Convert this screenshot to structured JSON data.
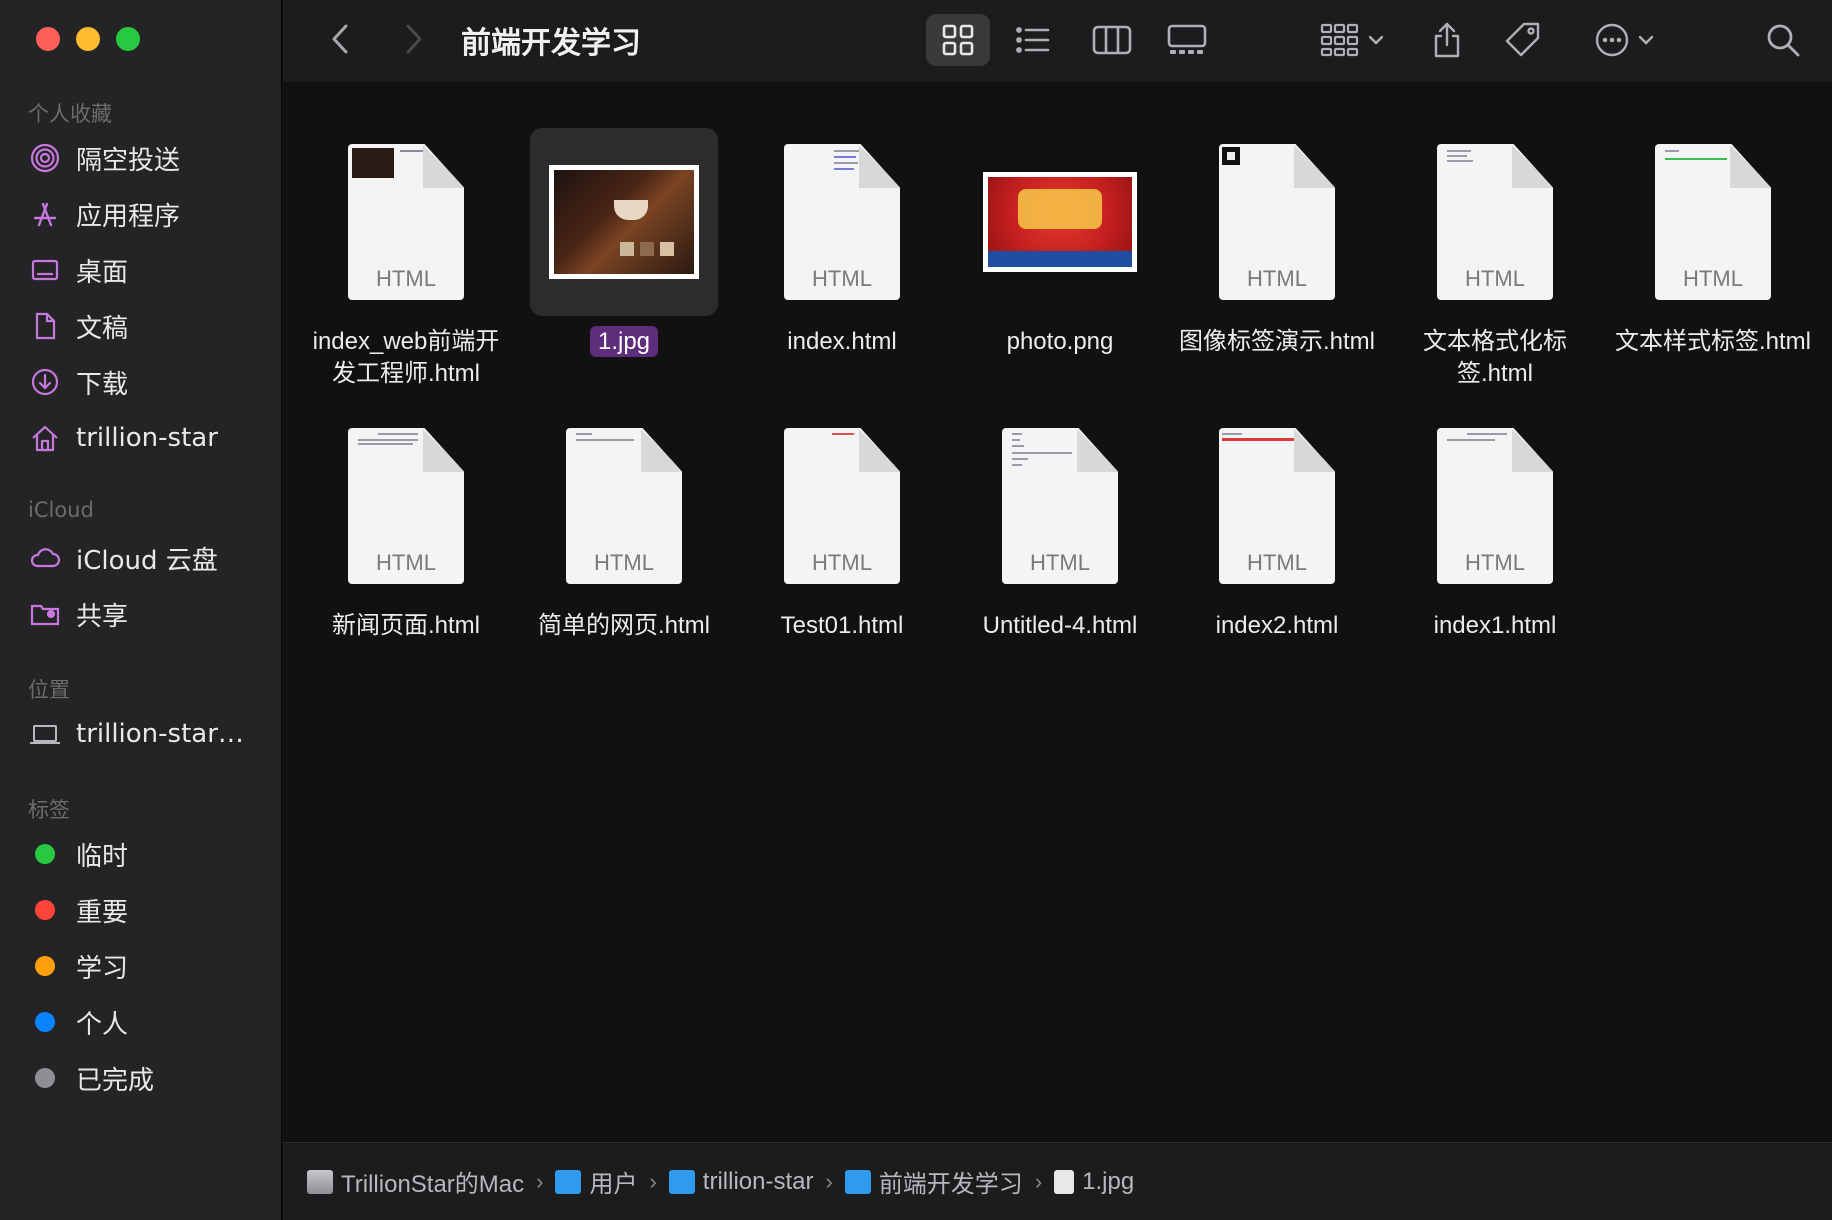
{
  "sidebar": {
    "favorites_header": "个人收藏",
    "favorites": [
      {
        "label": "隔空投送",
        "icon": "airdrop-icon"
      },
      {
        "label": "应用程序",
        "icon": "applications-icon"
      },
      {
        "label": "桌面",
        "icon": "desktop-icon"
      },
      {
        "label": "文稿",
        "icon": "document-icon"
      },
      {
        "label": "下载",
        "icon": "download-icon"
      },
      {
        "label": "trillion-star",
        "icon": "home-icon"
      }
    ],
    "icloud_header": "iCloud",
    "icloud": [
      {
        "label": "iCloud 云盘",
        "icon": "cloud-icon"
      },
      {
        "label": "共享",
        "icon": "shared-folder-icon"
      }
    ],
    "locations_header": "位置",
    "locations": [
      {
        "label": "trillion-star…",
        "icon": "laptop-icon"
      }
    ],
    "tags_header": "标签",
    "tags": [
      {
        "label": "临时",
        "color": "#28c840"
      },
      {
        "label": "重要",
        "color": "#ff453a"
      },
      {
        "label": "学习",
        "color": "#ff9f0a"
      },
      {
        "label": "个人",
        "color": "#0a84ff"
      },
      {
        "label": "已完成",
        "color": "#8e8e93"
      }
    ]
  },
  "toolbar": {
    "title": "前端开发学习",
    "view_mode": "icons"
  },
  "files": [
    {
      "name": "index_web前端开发工程师.html",
      "kind": "HTML",
      "type": "html-dark-preview"
    },
    {
      "name": "1.jpg",
      "kind": "JPG",
      "type": "jpg",
      "selected": true
    },
    {
      "name": "index.html",
      "kind": "HTML",
      "type": "html"
    },
    {
      "name": "photo.png",
      "kind": "PNG",
      "type": "png"
    },
    {
      "name": "图像标签演示.html",
      "kind": "HTML",
      "type": "html-img"
    },
    {
      "name": "文本格式化标签.html",
      "kind": "HTML",
      "type": "html"
    },
    {
      "name": "文本样式标签.html",
      "kind": "HTML",
      "type": "html-green"
    },
    {
      "name": "新闻页面.html",
      "kind": "HTML",
      "type": "html"
    },
    {
      "name": "简单的网页.html",
      "kind": "HTML",
      "type": "html"
    },
    {
      "name": "Test01.html",
      "kind": "HTML",
      "type": "html-red"
    },
    {
      "name": "Untitled-4.html",
      "kind": "HTML",
      "type": "html"
    },
    {
      "name": "index2.html",
      "kind": "HTML",
      "type": "html-redline"
    },
    {
      "name": "index1.html",
      "kind": "HTML",
      "type": "html"
    }
  ],
  "pathbar": [
    {
      "label": "TrillionStar的Mac",
      "icon": "disk-icon"
    },
    {
      "label": "用户",
      "icon": "folder-icon"
    },
    {
      "label": "trillion-star",
      "icon": "home-folder-icon"
    },
    {
      "label": "前端开发学习",
      "icon": "folder-icon"
    },
    {
      "label": "1.jpg",
      "icon": "file-icon"
    }
  ],
  "colors": {
    "selection": "#5e2d7c",
    "folder_blue": "#2f9bf0"
  }
}
